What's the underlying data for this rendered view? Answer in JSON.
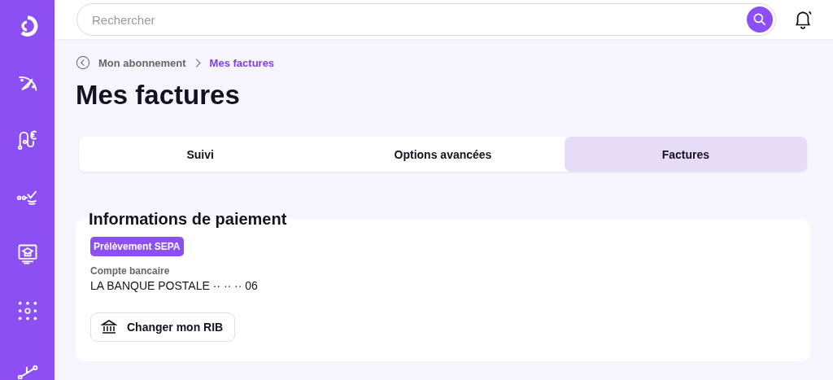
{
  "search": {
    "placeholder": "Rechercher"
  },
  "breadcrumb": [
    {
      "label": "Mon abonnement",
      "selected": false
    },
    {
      "label": "Mes factures",
      "selected": true
    }
  ],
  "title": "Mes factures",
  "tabs": [
    {
      "label": "Suivi",
      "selected": false
    },
    {
      "label": "Options avancées",
      "selected": false
    },
    {
      "label": "Factures",
      "selected": true
    }
  ],
  "payment": {
    "heading": "Informations de paiement",
    "badge": "Prélèvement SEPA",
    "account_label": "Compte bancaire",
    "account_value": "LA BANQUE POSTALE ·· ·· ·· 06",
    "button": "Changer mon RIB"
  }
}
